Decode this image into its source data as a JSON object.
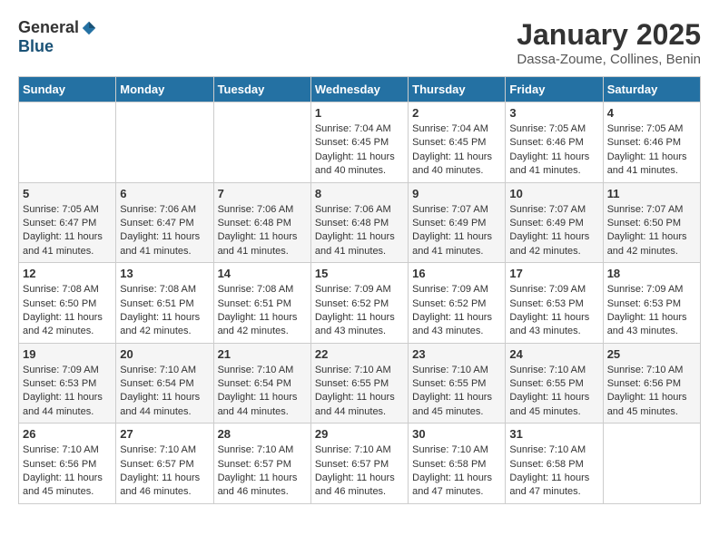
{
  "logo": {
    "general": "General",
    "blue": "Blue"
  },
  "title": "January 2025",
  "location": "Dassa-Zoume, Collines, Benin",
  "days": [
    "Sunday",
    "Monday",
    "Tuesday",
    "Wednesday",
    "Thursday",
    "Friday",
    "Saturday"
  ],
  "weeks": [
    [
      {
        "date": "",
        "info": ""
      },
      {
        "date": "",
        "info": ""
      },
      {
        "date": "",
        "info": ""
      },
      {
        "date": "1",
        "info": "Sunrise: 7:04 AM\nSunset: 6:45 PM\nDaylight: 11 hours\nand 40 minutes."
      },
      {
        "date": "2",
        "info": "Sunrise: 7:04 AM\nSunset: 6:45 PM\nDaylight: 11 hours\nand 40 minutes."
      },
      {
        "date": "3",
        "info": "Sunrise: 7:05 AM\nSunset: 6:46 PM\nDaylight: 11 hours\nand 41 minutes."
      },
      {
        "date": "4",
        "info": "Sunrise: 7:05 AM\nSunset: 6:46 PM\nDaylight: 11 hours\nand 41 minutes."
      }
    ],
    [
      {
        "date": "5",
        "info": "Sunrise: 7:05 AM\nSunset: 6:47 PM\nDaylight: 11 hours\nand 41 minutes."
      },
      {
        "date": "6",
        "info": "Sunrise: 7:06 AM\nSunset: 6:47 PM\nDaylight: 11 hours\nand 41 minutes."
      },
      {
        "date": "7",
        "info": "Sunrise: 7:06 AM\nSunset: 6:48 PM\nDaylight: 11 hours\nand 41 minutes."
      },
      {
        "date": "8",
        "info": "Sunrise: 7:06 AM\nSunset: 6:48 PM\nDaylight: 11 hours\nand 41 minutes."
      },
      {
        "date": "9",
        "info": "Sunrise: 7:07 AM\nSunset: 6:49 PM\nDaylight: 11 hours\nand 41 minutes."
      },
      {
        "date": "10",
        "info": "Sunrise: 7:07 AM\nSunset: 6:49 PM\nDaylight: 11 hours\nand 42 minutes."
      },
      {
        "date": "11",
        "info": "Sunrise: 7:07 AM\nSunset: 6:50 PM\nDaylight: 11 hours\nand 42 minutes."
      }
    ],
    [
      {
        "date": "12",
        "info": "Sunrise: 7:08 AM\nSunset: 6:50 PM\nDaylight: 11 hours\nand 42 minutes."
      },
      {
        "date": "13",
        "info": "Sunrise: 7:08 AM\nSunset: 6:51 PM\nDaylight: 11 hours\nand 42 minutes."
      },
      {
        "date": "14",
        "info": "Sunrise: 7:08 AM\nSunset: 6:51 PM\nDaylight: 11 hours\nand 42 minutes."
      },
      {
        "date": "15",
        "info": "Sunrise: 7:09 AM\nSunset: 6:52 PM\nDaylight: 11 hours\nand 43 minutes."
      },
      {
        "date": "16",
        "info": "Sunrise: 7:09 AM\nSunset: 6:52 PM\nDaylight: 11 hours\nand 43 minutes."
      },
      {
        "date": "17",
        "info": "Sunrise: 7:09 AM\nSunset: 6:53 PM\nDaylight: 11 hours\nand 43 minutes."
      },
      {
        "date": "18",
        "info": "Sunrise: 7:09 AM\nSunset: 6:53 PM\nDaylight: 11 hours\nand 43 minutes."
      }
    ],
    [
      {
        "date": "19",
        "info": "Sunrise: 7:09 AM\nSunset: 6:53 PM\nDaylight: 11 hours\nand 44 minutes."
      },
      {
        "date": "20",
        "info": "Sunrise: 7:10 AM\nSunset: 6:54 PM\nDaylight: 11 hours\nand 44 minutes."
      },
      {
        "date": "21",
        "info": "Sunrise: 7:10 AM\nSunset: 6:54 PM\nDaylight: 11 hours\nand 44 minutes."
      },
      {
        "date": "22",
        "info": "Sunrise: 7:10 AM\nSunset: 6:55 PM\nDaylight: 11 hours\nand 44 minutes."
      },
      {
        "date": "23",
        "info": "Sunrise: 7:10 AM\nSunset: 6:55 PM\nDaylight: 11 hours\nand 45 minutes."
      },
      {
        "date": "24",
        "info": "Sunrise: 7:10 AM\nSunset: 6:55 PM\nDaylight: 11 hours\nand 45 minutes."
      },
      {
        "date": "25",
        "info": "Sunrise: 7:10 AM\nSunset: 6:56 PM\nDaylight: 11 hours\nand 45 minutes."
      }
    ],
    [
      {
        "date": "26",
        "info": "Sunrise: 7:10 AM\nSunset: 6:56 PM\nDaylight: 11 hours\nand 45 minutes."
      },
      {
        "date": "27",
        "info": "Sunrise: 7:10 AM\nSunset: 6:57 PM\nDaylight: 11 hours\nand 46 minutes."
      },
      {
        "date": "28",
        "info": "Sunrise: 7:10 AM\nSunset: 6:57 PM\nDaylight: 11 hours\nand 46 minutes."
      },
      {
        "date": "29",
        "info": "Sunrise: 7:10 AM\nSunset: 6:57 PM\nDaylight: 11 hours\nand 46 minutes."
      },
      {
        "date": "30",
        "info": "Sunrise: 7:10 AM\nSunset: 6:58 PM\nDaylight: 11 hours\nand 47 minutes."
      },
      {
        "date": "31",
        "info": "Sunrise: 7:10 AM\nSunset: 6:58 PM\nDaylight: 11 hours\nand 47 minutes."
      },
      {
        "date": "",
        "info": ""
      }
    ]
  ]
}
